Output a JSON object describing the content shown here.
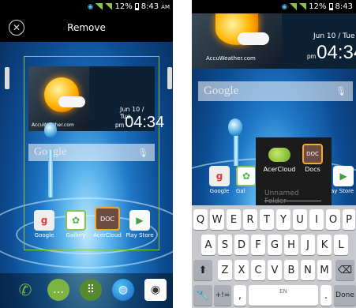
{
  "status": {
    "battery": "12%",
    "time": "8:43",
    "ampm": "AM"
  },
  "left_screen": {
    "topbar": {
      "remove_label": "Remove"
    },
    "weather": {
      "brand": "AccuWeather.com",
      "date": "Jun 10 / Tue",
      "pm": "pm",
      "time": "04:34"
    },
    "search": {
      "label": "Google"
    },
    "apps": [
      {
        "label": "Google",
        "icon": "google-folder-icon"
      },
      {
        "label": "Gallery",
        "icon": "gallery-icon"
      },
      {
        "label": "AcerCloud",
        "icon": "acercloud-icon"
      },
      {
        "label": "Play Store",
        "icon": "play-store-icon"
      }
    ],
    "dock": [
      "phone-icon",
      "messaging-icon",
      "app-drawer-icon",
      "browser-icon",
      "camera-icon"
    ]
  },
  "right_screen": {
    "weather": {
      "brand": "AccuWeather.com",
      "date": "Jun 10 / Tue",
      "pm": "pm",
      "time": "04:34"
    },
    "search": {
      "label": "Google"
    },
    "folder": {
      "apps": [
        {
          "label": "AcerCloud"
        },
        {
          "label": "Docs"
        }
      ],
      "name_placeholder": "Unnamed Folder"
    },
    "behind_labels": {
      "google": "Google",
      "gallery": "Gal",
      "play_store": "ay Store"
    },
    "keyboard": {
      "row1": [
        "Q",
        "W",
        "E",
        "R",
        "T",
        "Y",
        "U",
        "I",
        "O",
        "P"
      ],
      "row2": [
        "A",
        "S",
        "D",
        "F",
        "G",
        "H",
        "J",
        "K",
        "L"
      ],
      "row3": [
        "Z",
        "X",
        "C",
        "V",
        "B",
        "N",
        "M"
      ],
      "num_label": "+!=",
      "space_label": "EN",
      "comma": ",",
      "period": ".",
      "done_label": "Done"
    }
  }
}
